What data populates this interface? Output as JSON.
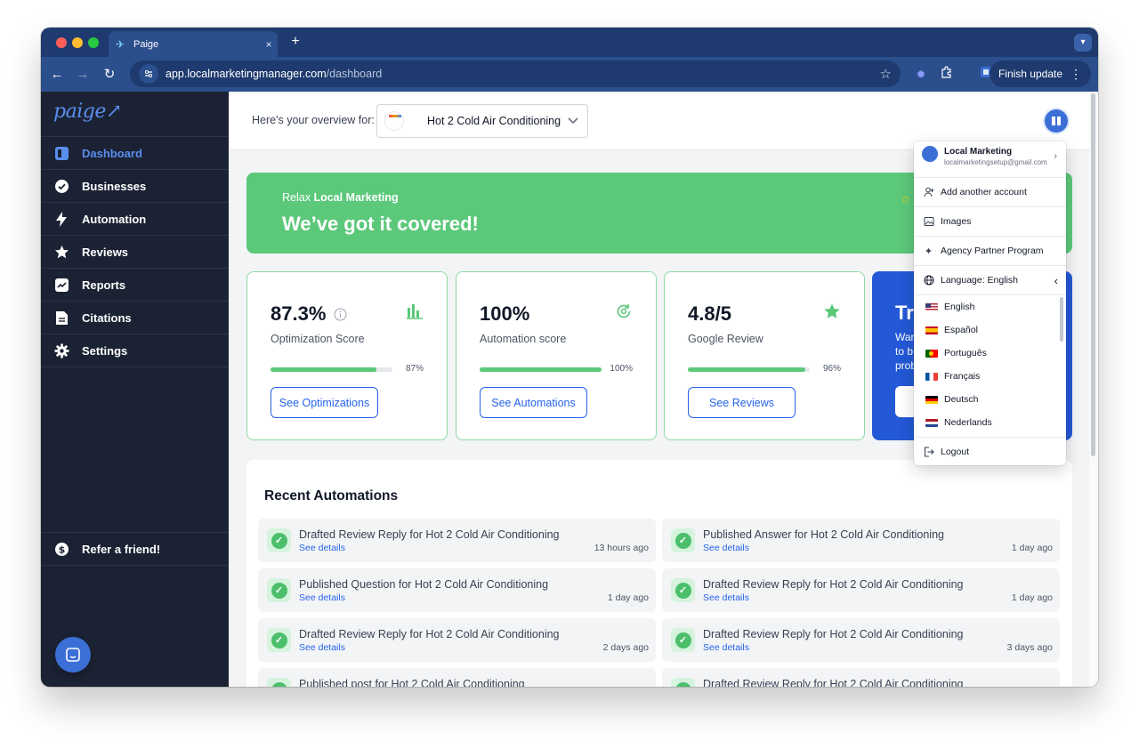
{
  "browser": {
    "tab_title": "Paige",
    "tab_close": "×",
    "new_tab": "+",
    "url_host": "app.localmarketingmanager.com",
    "url_path": "/dashboard",
    "finish_update": "Finish update",
    "colors": {
      "tabbar": "#1e3a6e",
      "toolbar": "#2b4e8c"
    }
  },
  "sidebar": {
    "logo": "paige↗",
    "items": [
      {
        "label": "Dashboard",
        "icon": "dashboard-icon"
      },
      {
        "label": "Businesses",
        "icon": "verified-check-icon"
      },
      {
        "label": "Automation",
        "icon": "lightning-icon"
      },
      {
        "label": "Reviews",
        "icon": "star-icon"
      },
      {
        "label": "Reports",
        "icon": "chart-icon"
      },
      {
        "label": "Citations",
        "icon": "document-icon"
      },
      {
        "label": "Settings",
        "icon": "gear-icon"
      }
    ],
    "refer": {
      "label": "Refer a friend!",
      "icon": "dollar-badge-icon"
    },
    "colors": {
      "background": "#1b2233",
      "active": "#5b8def"
    }
  },
  "topbar": {
    "overview_label": "Here's your overview for:",
    "business_name": "Hot 2 Cold Air Conditioning"
  },
  "banner": {
    "sub_prefix": "Relax ",
    "sub_name": "Local Marketing",
    "title": "We’ve got it covered!",
    "color": "#5cc87a"
  },
  "cards": [
    {
      "value": "87.3%",
      "label": "Optimization Score",
      "progress": 87,
      "progress_text": "87%",
      "button": "See Optimizations",
      "icon": "bar-chart-icon"
    },
    {
      "value": "100%",
      "label": "Automation score",
      "progress": 100,
      "progress_text": "100%",
      "button": "See Automations",
      "icon": "refresh-gear-icon"
    },
    {
      "value": "4.8/5",
      "label": "Google Review",
      "progress": 96,
      "progress_text": "96%",
      "button": "See Reviews",
      "icon": "star-icon"
    }
  ],
  "trial_card": {
    "title": "Tr",
    "text_lines": [
      "Wan",
      "to b",
      "prob"
    ],
    "color": "#2358d6"
  },
  "recent": {
    "title": "Recent Automations",
    "link_label": "See details",
    "items": [
      {
        "title": "Drafted Review Reply for Hot 2 Cold Air Conditioning",
        "time": "13 hours ago"
      },
      {
        "title": "Published Answer for Hot 2 Cold Air Conditioning",
        "time": "1 day ago"
      },
      {
        "title": "Published Question for Hot 2 Cold Air Conditioning",
        "time": "1 day ago"
      },
      {
        "title": "Drafted Review Reply for Hot 2 Cold Air Conditioning",
        "time": "1 day ago"
      },
      {
        "title": "Drafted Review Reply for Hot 2 Cold Air Conditioning",
        "time": "2 days ago"
      },
      {
        "title": "Drafted Review Reply for Hot 2 Cold Air Conditioning",
        "time": "3 days ago"
      },
      {
        "title": "Published post for Hot 2 Cold Air Conditioning",
        "time": ""
      },
      {
        "title": "Drafted Review Reply for Hot 2 Cold Air Conditioning",
        "time": ""
      }
    ]
  },
  "menu": {
    "account_name": "Local Marketing",
    "account_email": "localmarketingsetup@gmail.com",
    "items": [
      {
        "label": "Add another account",
        "icon": "add-person-icon"
      },
      {
        "label": "Images",
        "icon": "image-icon"
      },
      {
        "label": "Agency Partner Program",
        "icon": "sparkle-icon"
      }
    ],
    "language_label": "Language: English",
    "languages": [
      {
        "label": "English",
        "flag": "us-flag-icon"
      },
      {
        "label": "Español",
        "flag": "es-flag-icon"
      },
      {
        "label": "Português",
        "flag": "pt-flag-icon"
      },
      {
        "label": "Français",
        "flag": "fr-flag-icon"
      },
      {
        "label": "Deutsch",
        "flag": "de-flag-icon"
      },
      {
        "label": "Nederlands",
        "flag": "nl-flag-icon"
      }
    ],
    "logout": "Logout"
  }
}
